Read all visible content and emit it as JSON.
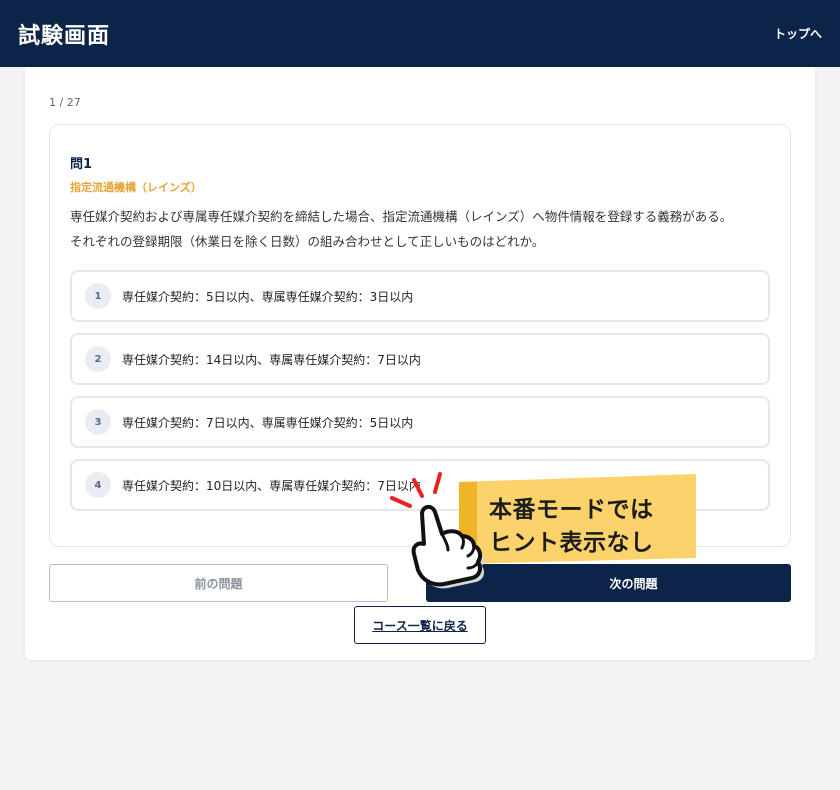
{
  "header": {
    "title": "試験画面",
    "top_link": "トップへ"
  },
  "progress": "1 / 27",
  "question": {
    "number": "問1",
    "category": "指定流通機構（レインズ）",
    "text_line1": "専任媒介契約および専属専任媒介契約を締結した場合、指定流通機構（レインズ）へ物件情報を登録する義務がある。",
    "text_line2": "それぞれの登録期限（休業日を除く日数）の組み合わせとして正しいものはどれか。"
  },
  "options": [
    {
      "num": "1",
      "text": "専任媒介契約：5日以内、専属専任媒介契約：3日以内"
    },
    {
      "num": "2",
      "text": "専任媒介契約：14日以内、専属専任媒介契約：7日以内"
    },
    {
      "num": "3",
      "text": "専任媒介契約：7日以内、専属専任媒介契約：5日以内"
    },
    {
      "num": "4",
      "text": "専任媒介契約：10日以内、専属専任媒介契約：7日以内"
    }
  ],
  "buttons": {
    "prev": "前の問題",
    "next": "次の問題",
    "back": "コース一覧に戻る"
  },
  "annotation": {
    "line1": "本番モードでは",
    "line2": "ヒント表示なし"
  },
  "colors": {
    "header_bg": "#0b2447",
    "category": "#e5a536",
    "note": "#fcd36a",
    "note_edge": "#f0b429"
  },
  "icons": {
    "hand": "pointing-hand-icon"
  }
}
